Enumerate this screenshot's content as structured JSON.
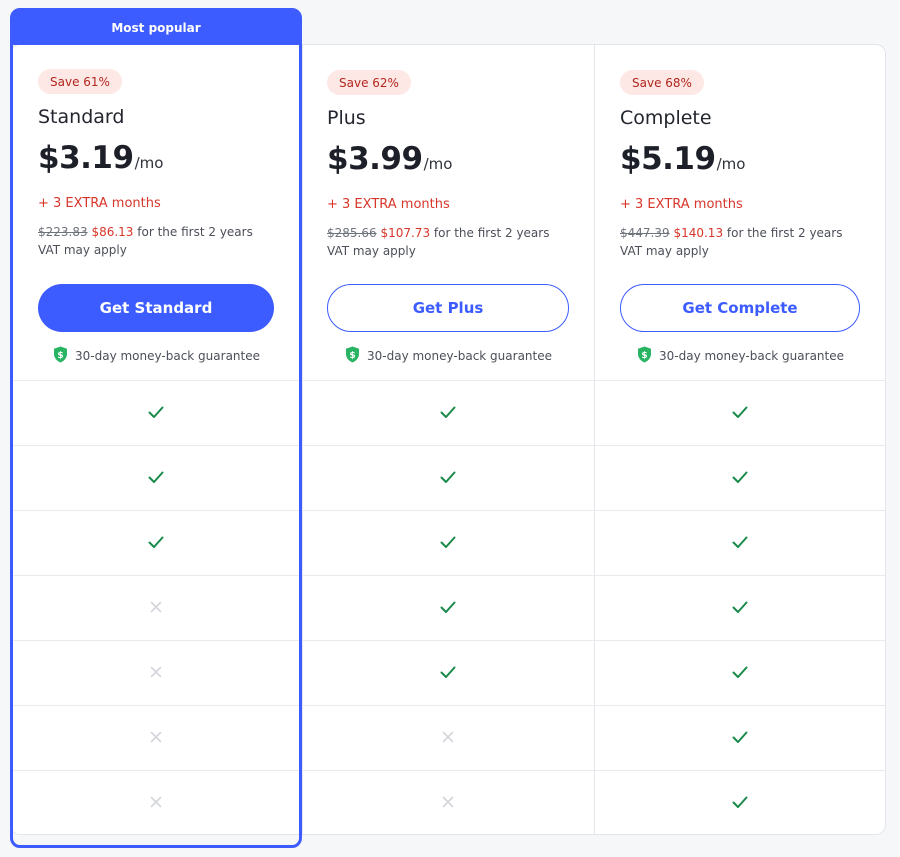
{
  "colors": {
    "accent": "#3d5cff",
    "save_badge_bg": "#fde8e6",
    "save_badge_text": "#b3261e",
    "promo_red": "#d8362a",
    "check_green": "#1a8a4a",
    "cross_gray": "#d4d6db",
    "shield_green": "#28b463"
  },
  "icons": {
    "included": "check-icon",
    "excluded": "cross-icon",
    "guarantee": "shield-dollar-icon"
  },
  "plans": [
    {
      "banner": "Most popular",
      "save_badge": "Save 61%",
      "name": "Standard",
      "price": "$3.19",
      "price_unit": "/mo",
      "extra": "+ 3 EXTRA months",
      "old_price": "$223.83",
      "new_price": "$86.13",
      "period_text": "for the first 2 years",
      "vat_note": "VAT may apply",
      "cta_label": "Get Standard",
      "guarantee": "30-day money-back guarantee",
      "features": [
        true,
        true,
        true,
        false,
        false,
        false,
        false
      ]
    },
    {
      "save_badge": "Save 62%",
      "name": "Plus",
      "price": "$3.99",
      "price_unit": "/mo",
      "extra": "+ 3 EXTRA months",
      "old_price": "$285.66",
      "new_price": "$107.73",
      "period_text": "for the first 2 years",
      "vat_note": "VAT may apply",
      "cta_label": "Get Plus",
      "guarantee": "30-day money-back guarantee",
      "features": [
        true,
        true,
        true,
        true,
        true,
        false,
        false
      ]
    },
    {
      "save_badge": "Save 68%",
      "name": "Complete",
      "price": "$5.19",
      "price_unit": "/mo",
      "extra": "+ 3 EXTRA months",
      "old_price": "$447.39",
      "new_price": "$140.13",
      "period_text": "for the first 2 years",
      "vat_note": "VAT may apply",
      "cta_label": "Get Complete",
      "guarantee": "30-day money-back guarantee",
      "features": [
        true,
        true,
        true,
        true,
        true,
        true,
        true
      ]
    }
  ]
}
